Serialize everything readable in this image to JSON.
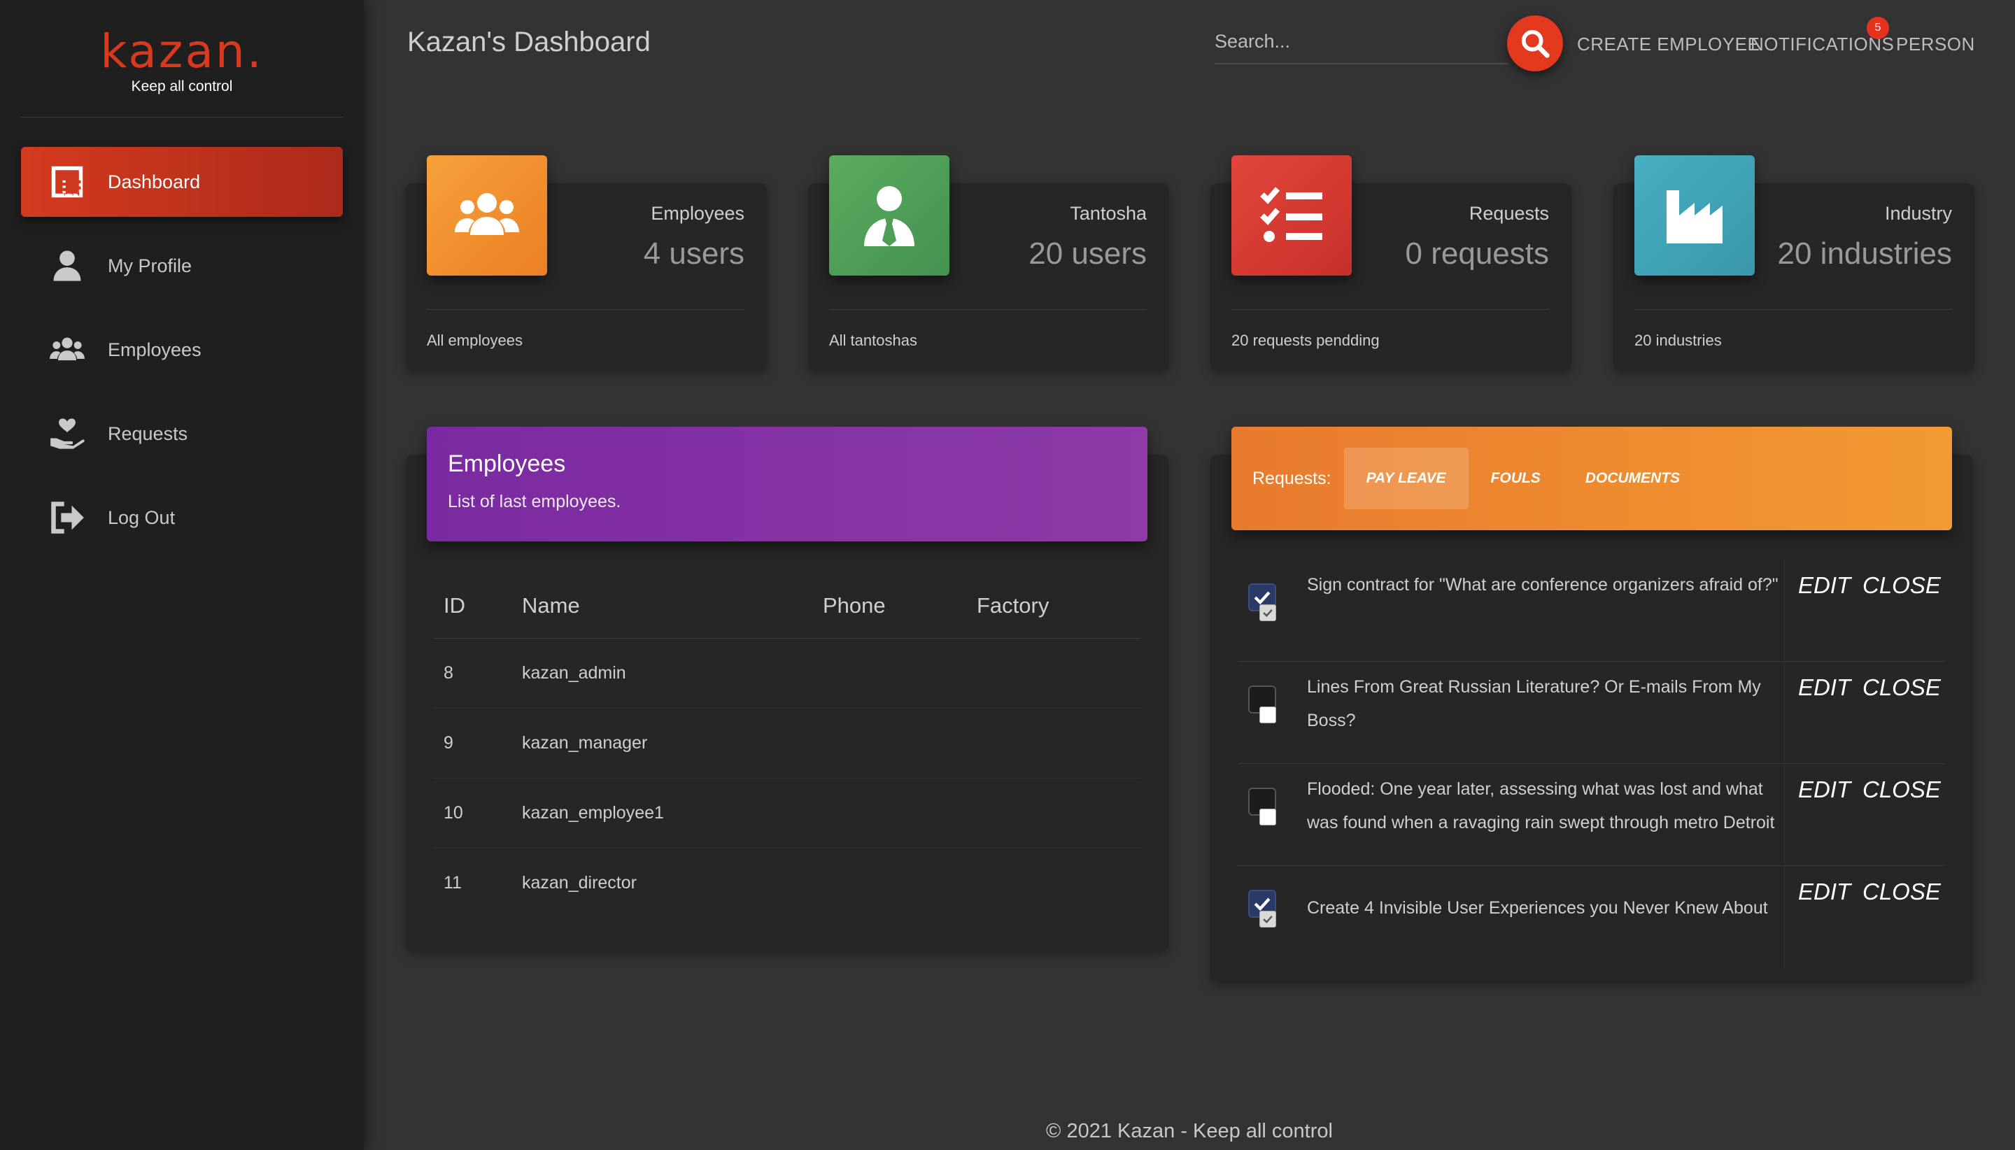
{
  "brand": {
    "logo": "kazan.",
    "tagline": "Keep all control",
    "color": "#d8391f"
  },
  "sidebar": {
    "items": [
      {
        "label": "Dashboard",
        "icon": "dashboard-icon",
        "active": true
      },
      {
        "label": "My Profile",
        "icon": "person-icon",
        "active": false
      },
      {
        "label": "Employees",
        "icon": "group-icon",
        "active": false
      },
      {
        "label": "Requests",
        "icon": "hand-heart-icon",
        "active": false
      },
      {
        "label": "Log Out",
        "icon": "logout-icon",
        "active": false
      }
    ]
  },
  "header": {
    "title": "Kazan's Dashboard",
    "search_placeholder": "Search...",
    "create_employee": "CREATE EMPLOYEE",
    "notifications": "NOTIFICATIONS",
    "notification_count": "5",
    "person": "PERSON"
  },
  "stats": [
    {
      "label": "Employees",
      "value": "4 users",
      "footer": "All employees",
      "color": "#f08f2e",
      "icon": "group-icon"
    },
    {
      "label": "Tantosha",
      "value": "20 users",
      "footer": "All tantoshas",
      "color": "#4e9e57",
      "icon": "user-tie-icon"
    },
    {
      "label": "Requests",
      "value": "0 requests",
      "footer": "20 requests pendding",
      "color": "#d23a30",
      "icon": "checklist-icon"
    },
    {
      "label": "Industry",
      "value": "20 industries",
      "footer": "20 industries",
      "color": "#40a4b8",
      "icon": "factory-icon"
    }
  ],
  "employees_panel": {
    "title": "Employees",
    "subtitle": "List of last employees.",
    "columns": [
      "ID",
      "Name",
      "Phone",
      "Factory"
    ],
    "rows": [
      {
        "id": "8",
        "name": "kazan_admin",
        "phone": "",
        "factory": ""
      },
      {
        "id": "9",
        "name": "kazan_manager",
        "phone": "",
        "factory": ""
      },
      {
        "id": "10",
        "name": "kazan_employee1",
        "phone": "",
        "factory": ""
      },
      {
        "id": "11",
        "name": "kazan_director",
        "phone": "",
        "factory": ""
      }
    ]
  },
  "requests_panel": {
    "label": "Requests:",
    "tabs": [
      "PAY LEAVE",
      "FOULS",
      "DOCUMENTS"
    ],
    "active_tab": "PAY LEAVE",
    "edit_label": "EDIT",
    "close_label": "CLOSE",
    "items": [
      {
        "text": "Sign contract for \"What are conference organizers afraid of?\"",
        "checked": true
      },
      {
        "text": "Lines From Great Russian Literature? Or E-mails From My Boss?",
        "checked": false
      },
      {
        "text": "Flooded: One year later, assessing what was lost and what was found when a ravaging rain swept through metro Detroit",
        "checked": false
      },
      {
        "text": "Create 4 Invisible User Experiences you Never Knew About",
        "checked": true
      }
    ]
  },
  "footer": "© 2021 Kazan - Keep all control"
}
